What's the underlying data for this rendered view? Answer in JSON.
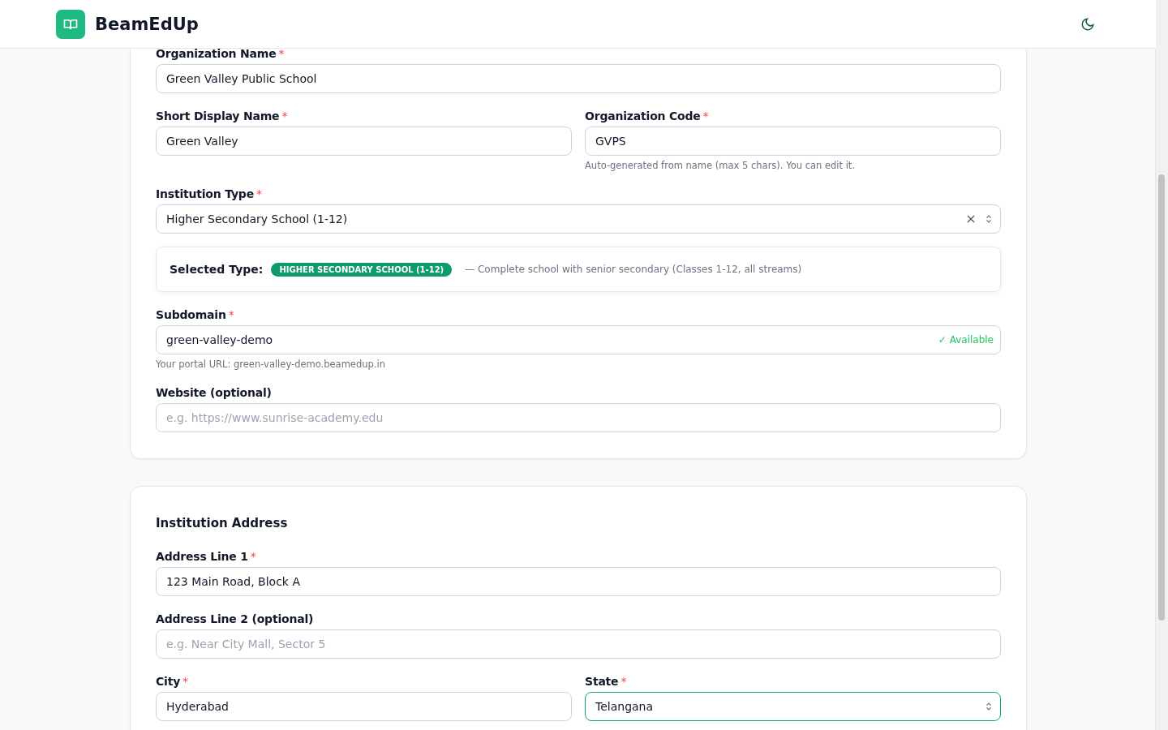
{
  "header": {
    "brand": "BeamEdUp"
  },
  "cards": [
    {
      "items": [
        {
          "kind": "row",
          "fields": [
            {
              "label": "Organization Name",
              "required_mark": "*",
              "kind": "input",
              "value": "Green Valley Public School"
            }
          ]
        },
        {
          "kind": "row",
          "fields": [
            {
              "label": "Short Display Name",
              "required_mark": "*",
              "kind": "input",
              "value": "Green Valley"
            },
            {
              "label": "Organization Code",
              "required_mark": "*",
              "kind": "input",
              "value": "GVPS",
              "hint": "Auto-generated from name (max 5 chars). You can edit it."
            }
          ]
        },
        {
          "kind": "row",
          "fields": [
            {
              "label": "Institution Type",
              "required_mark": "*",
              "kind": "select",
              "clearable": true,
              "value": "Higher Secondary School (1-12)"
            }
          ]
        },
        {
          "kind": "selected_type",
          "label": "Selected Type:",
          "badge": "HIGHER SECONDARY SCHOOL (1-12)",
          "description": "— Complete school with senior secondary (Classes 1-12, all streams)"
        },
        {
          "kind": "row",
          "fields": [
            {
              "label": "Subdomain",
              "required_mark": "*",
              "kind": "input",
              "value": "green-valley-demo",
              "status": "✓ Available",
              "hint": "Your portal URL: green-valley-demo.beamedup.in"
            }
          ]
        },
        {
          "kind": "row",
          "fields": [
            {
              "label": "Website (optional)",
              "kind": "input",
              "placeholder": "e.g. https://www.sunrise-academy.edu"
            }
          ]
        }
      ]
    },
    {
      "title": "Institution Address",
      "items": [
        {
          "kind": "row",
          "fields": [
            {
              "label": "Address Line 1",
              "required_mark": "*",
              "kind": "input",
              "value": "123 Main Road, Block A"
            }
          ]
        },
        {
          "kind": "row",
          "fields": [
            {
              "label": "Address Line 2 (optional)",
              "kind": "input",
              "placeholder": "e.g. Near City Mall, Sector 5"
            }
          ]
        },
        {
          "kind": "row",
          "fields": [
            {
              "label": "City",
              "required_mark": "*",
              "kind": "input",
              "value": "Hyderabad"
            },
            {
              "label": "State",
              "required_mark": "*",
              "kind": "select",
              "focused": true,
              "value": "Telangana"
            }
          ]
        }
      ]
    }
  ]
}
